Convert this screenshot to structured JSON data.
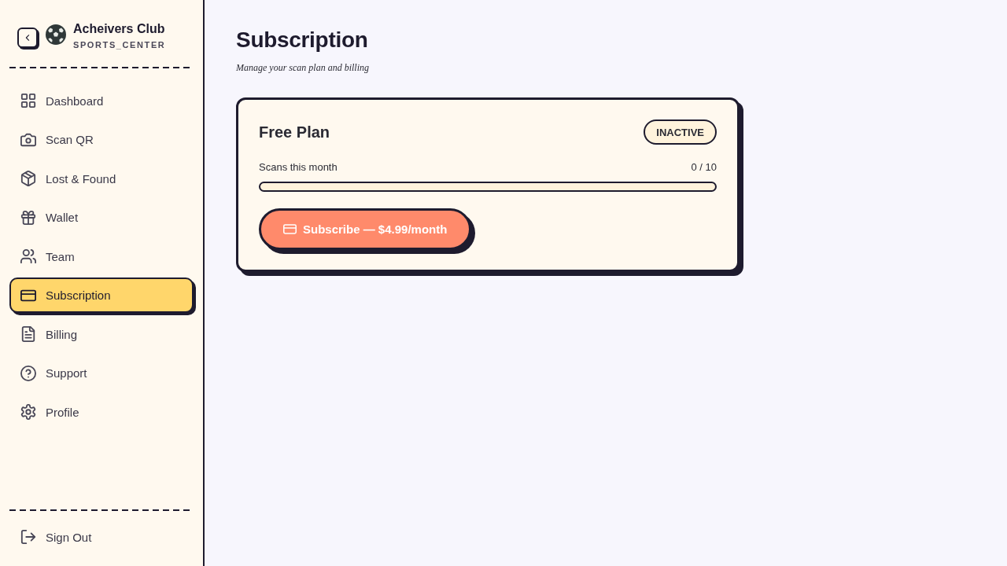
{
  "sidebar": {
    "brand": {
      "name": "Acheivers Club",
      "subtitle": "SPORTS_CENTER"
    },
    "items": [
      {
        "label": "Dashboard",
        "selected": false
      },
      {
        "label": "Scan QR",
        "selected": false
      },
      {
        "label": "Lost & Found",
        "selected": false
      },
      {
        "label": "Wallet",
        "selected": false
      },
      {
        "label": "Team",
        "selected": false
      },
      {
        "label": "Subscription",
        "selected": true
      },
      {
        "label": "Billing",
        "selected": false
      },
      {
        "label": "Support",
        "selected": false
      },
      {
        "label": "Profile",
        "selected": false
      }
    ],
    "sign_out": {
      "label": "Sign Out"
    }
  },
  "page": {
    "title": "Subscription",
    "subtitle": "Manage your scan plan and billing"
  },
  "plan": {
    "name": "Free Plan",
    "status": "INACTIVE",
    "usage_label": "Scans this month",
    "usage_reading": "0 / 10",
    "level": 0,
    "button": "Subscribe — $4.99/month"
  }
}
